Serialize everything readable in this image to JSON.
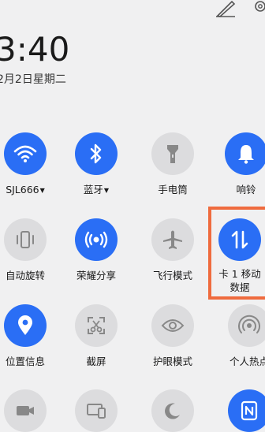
{
  "status": {
    "time": "3:40",
    "date": "2月2日星期二"
  },
  "tiles": [
    {
      "label": "SJL666",
      "has_caret": true,
      "active": true,
      "icon": "wifi-icon"
    },
    {
      "label": "蓝牙",
      "has_caret": true,
      "active": true,
      "icon": "bluetooth-icon"
    },
    {
      "label": "手电筒",
      "has_caret": false,
      "active": false,
      "icon": "flashlight-icon"
    },
    {
      "label": "响铃",
      "has_caret": false,
      "active": true,
      "icon": "bell-icon"
    },
    {
      "label": "自动旋转",
      "has_caret": false,
      "active": false,
      "icon": "auto-rotate-icon"
    },
    {
      "label": "荣耀分享",
      "has_caret": false,
      "active": true,
      "icon": "share-icon"
    },
    {
      "label": "飞行模式",
      "has_caret": false,
      "active": false,
      "icon": "airplane-icon"
    },
    {
      "label": "卡 1 移动",
      "label2": "数据",
      "has_caret": false,
      "active": true,
      "icon": "mobile-data-icon"
    },
    {
      "label": "位置信息",
      "has_caret": false,
      "active": true,
      "icon": "location-icon"
    },
    {
      "label": "截屏",
      "has_caret": false,
      "active": false,
      "icon": "screenshot-icon"
    },
    {
      "label": "护眼模式",
      "has_caret": false,
      "active": false,
      "icon": "eye-comfort-icon"
    },
    {
      "label": "个人热点",
      "has_caret": false,
      "active": false,
      "icon": "hotspot-icon"
    },
    {
      "label": "",
      "has_caret": false,
      "active": false,
      "icon": "screen-record-icon"
    },
    {
      "label": "",
      "has_caret": false,
      "active": false,
      "icon": "screen-cast-icon"
    },
    {
      "label": "",
      "has_caret": false,
      "active": false,
      "icon": "dark-mode-icon"
    },
    {
      "label": "",
      "has_caret": false,
      "active": true,
      "icon": "nfc-icon"
    }
  ],
  "colors": {
    "active": "#2a6ef5",
    "inactive": "#dcdcde",
    "highlight": "#ef6b3e"
  }
}
